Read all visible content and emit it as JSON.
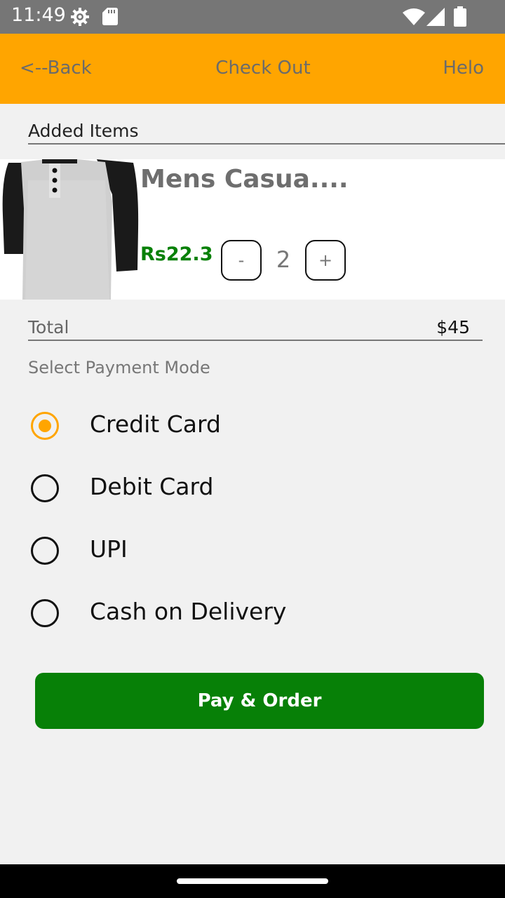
{
  "status_bar": {
    "time": "11:49",
    "icons": [
      "gear-icon",
      "sd-card-icon",
      "wifi-icon",
      "signal-icon",
      "battery-icon"
    ]
  },
  "app_bar": {
    "back_label": "<--Back",
    "title": "Check Out",
    "right_label": "Helo",
    "background_color": "#ffa500"
  },
  "cart": {
    "section_title": "Added Items",
    "items": [
      {
        "name": "Mens Casua....",
        "price": "Rs22.3",
        "quantity": "2",
        "decrement_label": "-",
        "increment_label": "+"
      }
    ]
  },
  "total": {
    "label": "Total",
    "value": "$45"
  },
  "payment": {
    "title": "Select Payment Mode",
    "options": [
      {
        "label": "Credit Card",
        "selected": true
      },
      {
        "label": "Debit Card",
        "selected": false
      },
      {
        "label": "UPI",
        "selected": false
      },
      {
        "label": "Cash on Delivery",
        "selected": false
      }
    ],
    "accent_color": "#ffa500"
  },
  "pay_button": {
    "label": "Pay & Order",
    "color": "#078007"
  }
}
